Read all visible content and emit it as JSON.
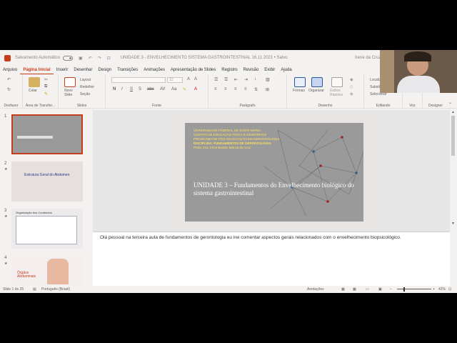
{
  "titlebar": {
    "autosave": "Salvamento Automático",
    "title": "UNIDADE 3 - ENVELHECIMENTO SISTEMA GASTROINTESTINAL 16.11.2021 • Salvo",
    "user": "Irene da Cruz"
  },
  "menu": [
    "Arquivo",
    "Página Inicial",
    "Inserir",
    "Desenhar",
    "Design",
    "Transições",
    "Animações",
    "Apresentação de Slides",
    "Registro",
    "Revisão",
    "Exibir",
    "Ajuda"
  ],
  "ribbon": {
    "undo_label": "Desfazer",
    "clipboard": {
      "paste": "Colar",
      "label": "Área de Transfer..."
    },
    "slides": {
      "new": "Novo\nSlide",
      "layout": "Layout",
      "reset": "Redefinir",
      "section": "Seção",
      "label": "Slides"
    },
    "font": {
      "label": "Fonte",
      "size": "12"
    },
    "paragraph": {
      "label": "Parágrafo"
    },
    "drawing": {
      "shapes": "Formas",
      "arrange": "Organizar",
      "quick_styles": "Estilos\nRápidos",
      "label": "Desenho"
    },
    "editing": {
      "find": "Localizar",
      "replace": "Substituir",
      "select": "Selecionar",
      "label": "Editando"
    },
    "voice": {
      "dictate": "Ditar",
      "label": "Voz"
    },
    "designer": {
      "label": "Designer"
    }
  },
  "slides": [
    {
      "num": "1"
    },
    {
      "num": "2",
      "title": "Estrutura Geral do Abdomen"
    },
    {
      "num": "3",
      "title": "Organização dos Conteúdos"
    },
    {
      "num": "4",
      "title": "Órgãos\nAbdominais"
    }
  ],
  "current_slide": {
    "lines": [
      "UNIVERSIDADE FEDERAL DE SANTA MARIA",
      "CENTRO DE EDUCAÇÃO FÍSICA E DESPORTOS",
      "PROGRAMA DE PÓS-GRADUAÇÃO EM GERONTOLOGIA",
      "DISCIPLINA: FUNDAMENTOS DE GERONTOLOGIA",
      "Profa. Dra. Irene Beatriz Márcia da Cruz"
    ],
    "title": "UNIDADE 3 – Fundamentos do Envelhecimento biológico do sistema gastrointestinal"
  },
  "notes": "Olá pessoal na terceira aula de fundamentos de gerontologia eu irei comentar aspectos gerais relacionados com o envelhecimento biopsicológico.",
  "status": {
    "slide_count": "Slide 1 de 25",
    "language": "Português (Brasil)",
    "notes": "Anotações",
    "zoom": "42%"
  },
  "colors": {
    "accent": "#c43e1c",
    "slide_text": "#ffe15a"
  }
}
